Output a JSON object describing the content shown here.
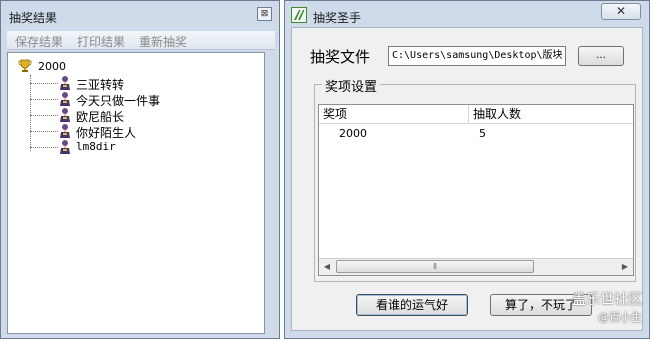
{
  "left_window": {
    "title": "抽奖结果",
    "close_glyph": "⊠",
    "toolbar": [
      "保存结果",
      "打印结果",
      "重新抽奖"
    ],
    "tree": {
      "root": "2000",
      "children": [
        "三亚转转",
        "今天只做一件事",
        "欧尼船长",
        "你好陌生人",
        "lm8dir"
      ]
    }
  },
  "right_window": {
    "title": "抽奖圣手",
    "close_glyph": "✕",
    "file_label": "抽奖文件",
    "file_path": "C:\\Users\\samsung\\Desktop\\版块",
    "browse_label": "...",
    "group_title": "奖项设置",
    "table": {
      "columns": [
        "奖项",
        "抽取人数"
      ],
      "rows": [
        [
          "2000",
          "5"
        ]
      ]
    },
    "scroll_thumb": "⦀",
    "buttons": {
      "lucky": "看谁的运气好",
      "quit": "算了，不玩了"
    }
  },
  "watermark": {
    "line1": "盖乐世社区",
    "line2": "@百小生"
  },
  "colors": {
    "frame": "#cfdbea",
    "client": "#f0f0f0",
    "accent": "#3a8a2e"
  }
}
